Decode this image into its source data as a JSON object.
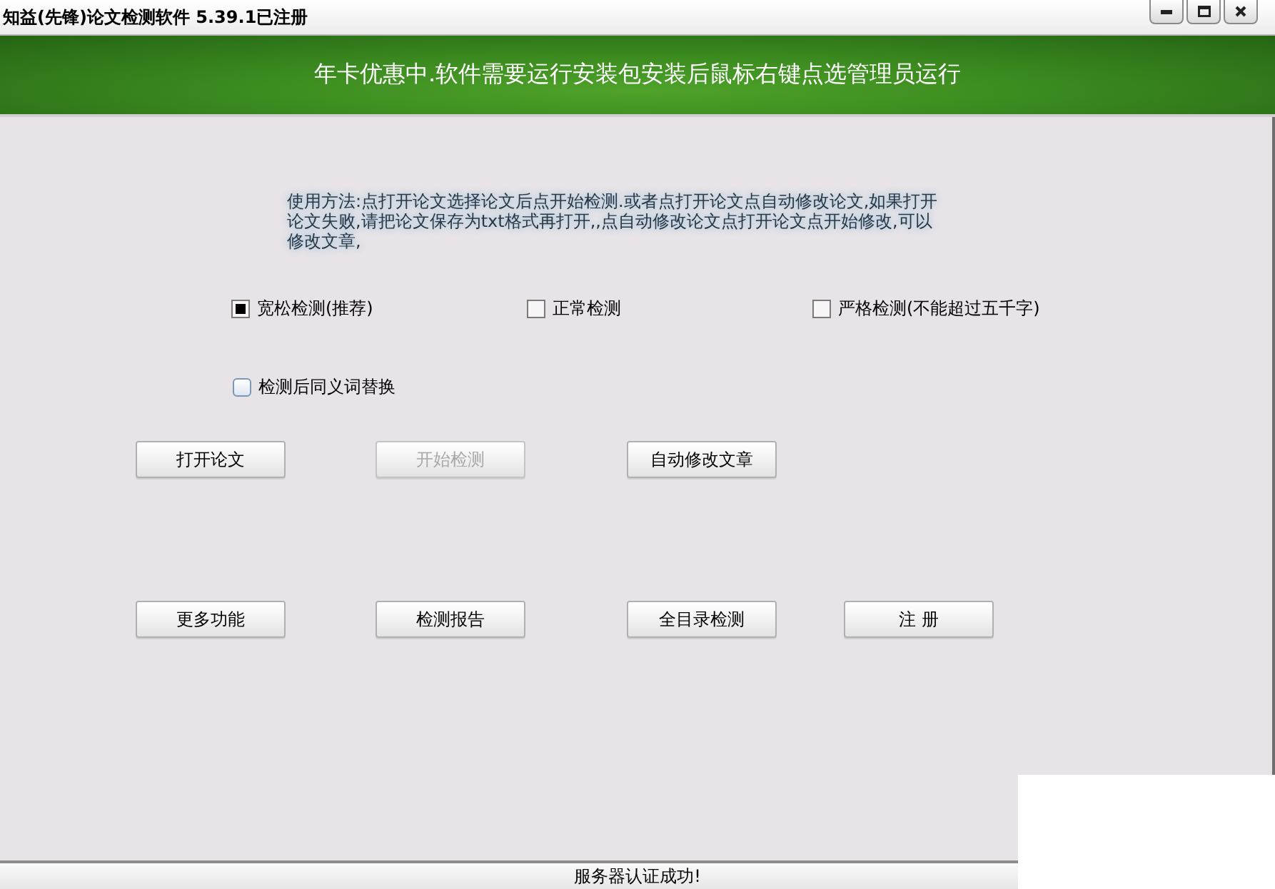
{
  "window": {
    "title": "知益(先锋)论文检测软件 5.39.1已注册"
  },
  "banner": {
    "text": "年卡优惠中.软件需要运行安装包安装后鼠标右键点选管理员运行"
  },
  "instructions": "使用方法:点打开论文选择论文后点开始检测.或者点打开论文点自动修改论文,如果打开论文失败,请把论文保存为txt格式再打开,,点自动修改论文点打开论文点开始修改,可以修改文章,",
  "modes": [
    {
      "label": "宽松检测(推荐)",
      "checked": true
    },
    {
      "label": "正常检测",
      "checked": false
    },
    {
      "label": "严格检测(不能超过五千字)",
      "checked": false
    }
  ],
  "options": [
    {
      "label": "检测后同义词替换",
      "checked": false
    }
  ],
  "button_rows": [
    {
      "buttons": [
        {
          "label": "打开论文",
          "disabled": false
        },
        {
          "label": "开始检测",
          "disabled": true
        },
        {
          "label": "自动修改文章",
          "disabled": false
        }
      ]
    },
    {
      "buttons": [
        {
          "label": "更多功能",
          "disabled": false
        },
        {
          "label": "检测报告",
          "disabled": false
        },
        {
          "label": "全目录检测",
          "disabled": false
        },
        {
          "label": "注 册",
          "disabled": false
        }
      ]
    }
  ],
  "status_bar": {
    "text": "服务器认证成功!"
  }
}
